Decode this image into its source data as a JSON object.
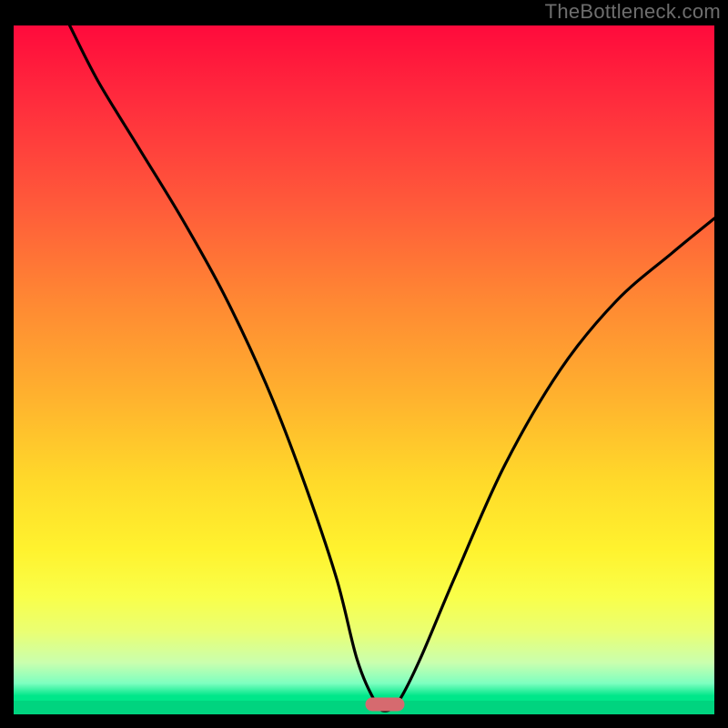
{
  "watermark": "TheBottleneck.com",
  "chart_data": {
    "type": "line",
    "title": "",
    "xlabel": "",
    "ylabel": "",
    "xlim": [
      0,
      100
    ],
    "ylim": [
      0,
      100
    ],
    "gradient_stops": [
      {
        "pct": 0,
        "color": "#ff0a3c"
      },
      {
        "pct": 12,
        "color": "#ff2f3d"
      },
      {
        "pct": 26,
        "color": "#ff5a3a"
      },
      {
        "pct": 40,
        "color": "#ff8833"
      },
      {
        "pct": 54,
        "color": "#ffb22e"
      },
      {
        "pct": 66,
        "color": "#ffd92a"
      },
      {
        "pct": 76,
        "color": "#fff22e"
      },
      {
        "pct": 83,
        "color": "#f9ff4a"
      },
      {
        "pct": 88,
        "color": "#eaff73"
      },
      {
        "pct": 92.5,
        "color": "#caffae"
      },
      {
        "pct": 95.5,
        "color": "#7dffc0"
      },
      {
        "pct": 97.3,
        "color": "#00e78a"
      },
      {
        "pct": 100,
        "color": "#00e78a"
      }
    ],
    "series": [
      {
        "name": "bottleneck-curve",
        "x": [
          8,
          12,
          18,
          24,
          30,
          36,
          41,
          46,
          49,
          51.5,
          53,
          55,
          58,
          63,
          70,
          78,
          86,
          94,
          100
        ],
        "y": [
          100,
          92,
          82,
          72,
          61,
          48,
          35,
          20,
          8,
          2,
          0.5,
          2,
          8,
          20,
          36,
          50,
          60,
          67,
          72
        ]
      }
    ],
    "marker": {
      "x": 53,
      "y": 1.5,
      "color": "#d66a6f"
    }
  }
}
